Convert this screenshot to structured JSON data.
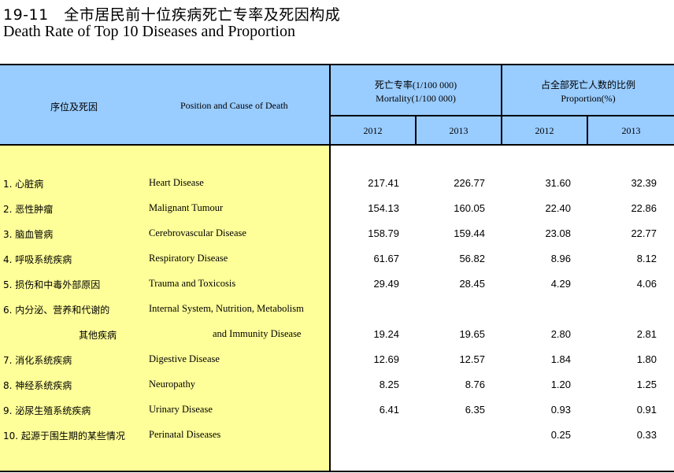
{
  "title": {
    "cn": "19-11　全市居民前十位疾病死亡专率及死因构成",
    "en": "Death Rate of Top 10 Diseases and Proportion"
  },
  "header": {
    "col_cause_cn": "序位及死因",
    "col_cause_en": "Position and Cause of Death",
    "mortality_cn": "死亡专率(1/100 000)",
    "mortality_en": "Mortality(1/100 000)",
    "proportion_cn": "占全部死亡人数的比例",
    "proportion_en": "Proportion(%)",
    "years": [
      "2012",
      "2013",
      "2012",
      "2013"
    ]
  },
  "rows": [
    {
      "cn": "1.  心脏病",
      "en": "Heart Disease",
      "m2012": "217.41",
      "m2013": "226.77",
      "p2012": "31.60",
      "p2013": "32.39"
    },
    {
      "cn": "2.  恶性肿瘤",
      "en": "Malignant Tumour",
      "m2012": "154.13",
      "m2013": "160.05",
      "p2012": "22.40",
      "p2013": "22.86"
    },
    {
      "cn": "3.  脑血管病",
      "en": "Cerebrovascular Disease",
      "m2012": "158.79",
      "m2013": "159.44",
      "p2012": "23.08",
      "p2013": "22.77"
    },
    {
      "cn": "4.  呼吸系统疾病",
      "en": "Respiratory Disease",
      "m2012": "61.67",
      "m2013": "56.82",
      "p2012": "8.96",
      "p2013": "8.12"
    },
    {
      "cn": "5.  损伤和中毒外部原因",
      "en": "Trauma and Toxicosis",
      "m2012": "29.49",
      "m2013": "28.45",
      "p2012": "4.29",
      "p2013": "4.06"
    },
    {
      "cn": "6.  内分泌、营养和代谢的",
      "en": "Internal System, Nutrition, Metabolism",
      "m2012": "",
      "m2013": "",
      "p2012": "",
      "p2013": ""
    },
    {
      "cn": "其他疾病",
      "en": "and Immunity Disease",
      "m2012": "19.24",
      "m2013": "19.65",
      "p2012": "2.80",
      "p2013": "2.81"
    },
    {
      "cn": "7.  消化系统疾病",
      "en": "Digestive Disease",
      "m2012": "12.69",
      "m2013": "12.57",
      "p2012": "1.84",
      "p2013": "1.80"
    },
    {
      "cn": "8.  神经系统疾病",
      "en": "Neuropathy",
      "m2012": "8.25",
      "m2013": "8.76",
      "p2012": "1.20",
      "p2013": "1.25"
    },
    {
      "cn": "9.  泌尿生殖系统疾病",
      "en": "Urinary Disease",
      "m2012": "6.41",
      "m2013": "6.35",
      "p2012": "0.93",
      "p2013": "0.91"
    },
    {
      "cn": "10. 起源于围生期的某些情况",
      "en": "Perinatal Diseases",
      "m2012": "",
      "m2013": "",
      "p2012": "0.25",
      "p2013": "0.33"
    }
  ]
}
